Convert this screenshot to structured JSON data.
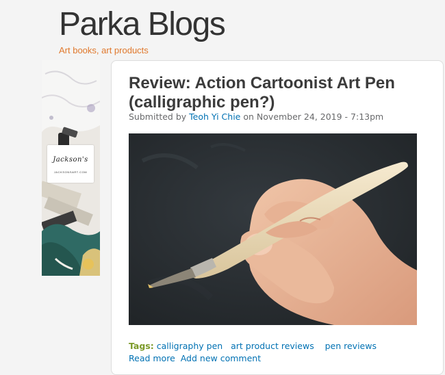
{
  "header": {
    "site_name": "Parka Blogs",
    "slogan": "Art books, art products"
  },
  "ad": {
    "brand": "Jackson's",
    "url": "JACKSONSART.COM"
  },
  "article": {
    "title": "Review: Action Cartoonist Art Pen (calligraphic pen?)",
    "submitted_prefix": "Submitted by",
    "author": "Teoh Yi Chie",
    "date_prefix": "on",
    "date": "November 24, 2019 - 7:13pm",
    "tags_label": "Tags:",
    "tags": [
      "calligraphy pen",
      "art product reviews",
      "pen reviews"
    ],
    "links": {
      "read_more": "Read more",
      "add_comment": "Add new comment"
    }
  },
  "colors": {
    "background": "#f4f4f4",
    "slogan": "#e0782c",
    "link": "#0071b3",
    "tags_label": "#7c9a2a",
    "title": "#3b3b3b"
  }
}
